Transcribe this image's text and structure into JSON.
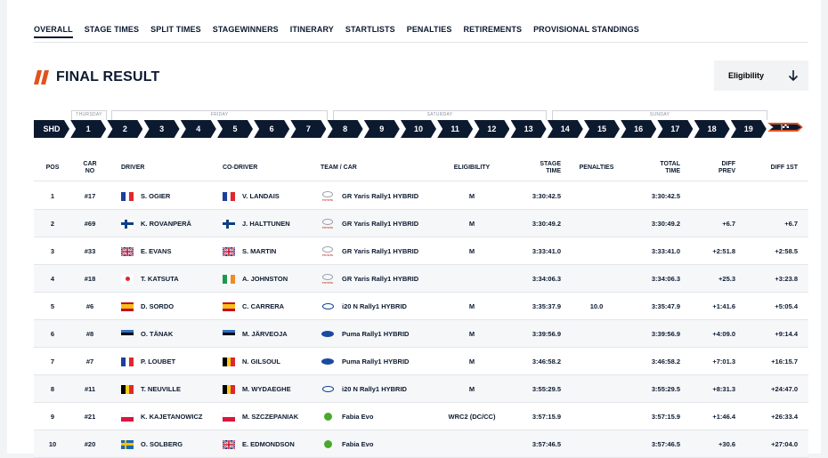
{
  "tabs": [
    "OVERALL",
    "STAGE TIMES",
    "SPLIT TIMES",
    "STAGEWINNERS",
    "ITINERARY",
    "STARTLISTS",
    "PENALTIES",
    "RETIREMENTS",
    "PROVISIONAL STANDINGS"
  ],
  "page_title": "FINAL RESULT",
  "eligibility_label": "Eligibility",
  "days": [
    "THURSDAY",
    "FRIDAY",
    "SATURDAY",
    "SUNDAY"
  ],
  "stages": [
    "SHD",
    "1",
    "2",
    "3",
    "4",
    "5",
    "6",
    "7",
    "8",
    "9",
    "10",
    "11",
    "12",
    "13",
    "14",
    "15",
    "16",
    "17",
    "18",
    "19"
  ],
  "colors": {
    "navy": "#0c1a30",
    "accent": "#e0531f"
  },
  "headers": {
    "pos": "POS",
    "car_no_1": "CAR",
    "car_no_2": "NO",
    "driver": "DRIVER",
    "codriver": "CO-DRIVER",
    "team": "TEAM / CAR",
    "eligibility": "ELIGIBILITY",
    "stage_time_1": "STAGE",
    "stage_time_2": "TIME",
    "penalties": "PENALTIES",
    "total_time_1": "TOTAL",
    "total_time_2": "TIME",
    "diff_prev_1": "DIFF",
    "diff_prev_2": "PREV",
    "diff_1st": "DIFF 1ST"
  },
  "rows": [
    {
      "pos": "1",
      "car": "#17",
      "driver": "S. OGIER",
      "driver_flag": "fr",
      "codriver": "V. LANDAIS",
      "codriver_flag": "fr",
      "team": "GR Yaris Rally1 HYBRID",
      "brand": "toyota",
      "eligibility": "M",
      "stage_time": "3:30:42.5",
      "penalties": "",
      "total_time": "3:30:42.5",
      "diff_prev": "",
      "diff_1st": ""
    },
    {
      "pos": "2",
      "car": "#69",
      "driver": "K. ROVANPERÄ",
      "driver_flag": "fi",
      "codriver": "J. HALTTUNEN",
      "codriver_flag": "fi",
      "team": "GR Yaris Rally1 HYBRID",
      "brand": "toyota",
      "eligibility": "M",
      "stage_time": "3:30:49.2",
      "penalties": "",
      "total_time": "3:30:49.2",
      "diff_prev": "+6.7",
      "diff_1st": "+6.7"
    },
    {
      "pos": "3",
      "car": "#33",
      "driver": "E. EVANS",
      "driver_flag": "gb",
      "codriver": "S. MARTIN",
      "codriver_flag": "gb",
      "team": "GR Yaris Rally1 HYBRID",
      "brand": "toyota",
      "eligibility": "M",
      "stage_time": "3:33:41.0",
      "penalties": "",
      "total_time": "3:33:41.0",
      "diff_prev": "+2:51.8",
      "diff_1st": "+2:58.5"
    },
    {
      "pos": "4",
      "car": "#18",
      "driver": "T. KATSUTA",
      "driver_flag": "jp",
      "codriver": "A. JOHNSTON",
      "codriver_flag": "ie",
      "team": "GR Yaris Rally1 HYBRID",
      "brand": "toyota",
      "eligibility": "",
      "stage_time": "3:34:06.3",
      "penalties": "",
      "total_time": "3:34:06.3",
      "diff_prev": "+25.3",
      "diff_1st": "+3:23.8"
    },
    {
      "pos": "5",
      "car": "#6",
      "driver": "D. SORDO",
      "driver_flag": "es",
      "codriver": "C. CARRERA",
      "codriver_flag": "es",
      "team": "i20 N Rally1 HYBRID",
      "brand": "hyundai",
      "eligibility": "M",
      "stage_time": "3:35:37.9",
      "penalties": "10.0",
      "total_time": "3:35:47.9",
      "diff_prev": "+1:41.6",
      "diff_1st": "+5:05.4"
    },
    {
      "pos": "6",
      "car": "#8",
      "driver": "O. TÄNAK",
      "driver_flag": "ee",
      "codriver": "M. JÄRVEOJA",
      "codriver_flag": "ee",
      "team": "Puma Rally1 HYBRID",
      "brand": "ford",
      "eligibility": "M",
      "stage_time": "3:39:56.9",
      "penalties": "",
      "total_time": "3:39:56.9",
      "diff_prev": "+4:09.0",
      "diff_1st": "+9:14.4"
    },
    {
      "pos": "7",
      "car": "#7",
      "driver": "P. LOUBET",
      "driver_flag": "fr",
      "codriver": "N. GILSOUL",
      "codriver_flag": "be",
      "team": "Puma Rally1 HYBRID",
      "brand": "ford",
      "eligibility": "M",
      "stage_time": "3:46:58.2",
      "penalties": "",
      "total_time": "3:46:58.2",
      "diff_prev": "+7:01.3",
      "diff_1st": "+16:15.7"
    },
    {
      "pos": "8",
      "car": "#11",
      "driver": "T. NEUVILLE",
      "driver_flag": "be",
      "codriver": "M. WYDAEGHE",
      "codriver_flag": "be",
      "team": "i20 N Rally1 HYBRID",
      "brand": "hyundai",
      "eligibility": "M",
      "stage_time": "3:55:29.5",
      "penalties": "",
      "total_time": "3:55:29.5",
      "diff_prev": "+8:31.3",
      "diff_1st": "+24:47.0"
    },
    {
      "pos": "9",
      "car": "#21",
      "driver": "K. KAJETANOWICZ",
      "driver_flag": "pl",
      "codriver": "M. SZCZEPANIAK",
      "codriver_flag": "pl",
      "team": "Fabia Evo",
      "brand": "skoda",
      "eligibility": "WRC2 (DC/CC)",
      "stage_time": "3:57:15.9",
      "penalties": "",
      "total_time": "3:57:15.9",
      "diff_prev": "+1:46.4",
      "diff_1st": "+26:33.4"
    },
    {
      "pos": "10",
      "car": "#20",
      "driver": "O. SOLBERG",
      "driver_flag": "se",
      "codriver": "E. EDMONDSON",
      "codriver_flag": "gb",
      "team": "Fabia Evo",
      "brand": "skoda",
      "eligibility": "",
      "stage_time": "3:57:46.5",
      "penalties": "",
      "total_time": "3:57:46.5",
      "diff_prev": "+30.6",
      "diff_1st": "+27:04.0"
    }
  ]
}
